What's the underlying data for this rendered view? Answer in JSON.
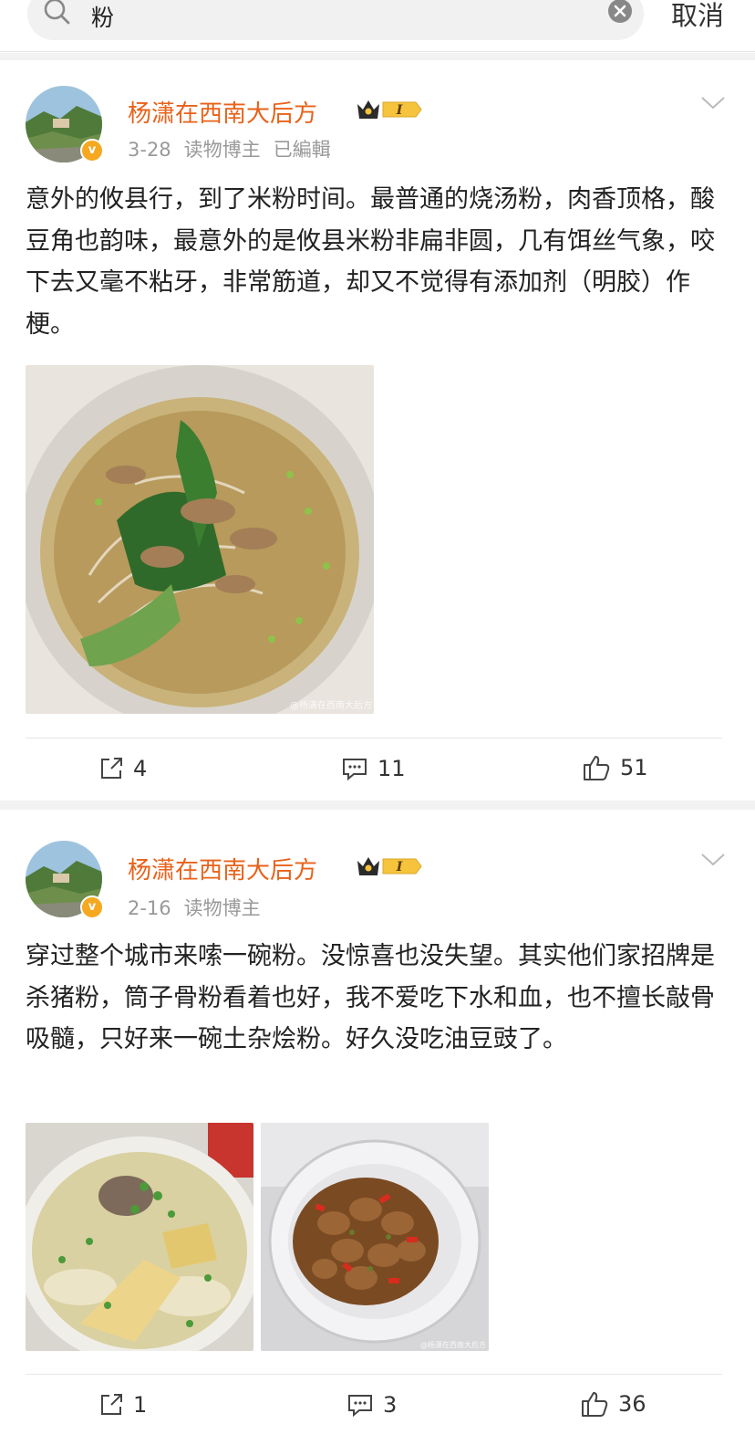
{
  "search": {
    "query": "粉",
    "cancel_label": "取消"
  },
  "posts": [
    {
      "author": "杨潇在西南大后方",
      "badge_level": "I",
      "date": "3-28",
      "tag": "读物博主",
      "edited": "已編輯",
      "text": "意外的攸县行，到了米粉时间。最普通的烧汤粉，肉香顶格，酸豆角也韵味，最意外的是攸县米粉非扁非圆，几有饵丝气象，咬下去又毫不粘牙，非常筋道，却又不觉得有添加剂（明胶）作梗。",
      "image_watermark": "@杨潇在西南大后方",
      "reposts": "4",
      "comments": "11",
      "likes": "51"
    },
    {
      "author": "杨潇在西南大后方",
      "badge_level": "I",
      "date": "2-16",
      "tag": "读物博主",
      "text": "穿过整个城市来嗦一碗粉。没惊喜也没失望。其实他们家招牌是杀猪粉，筒子骨粉看着也好，我不爱吃下水和血，也不擅长敲骨吸髓，只好来一碗土杂烩粉。好久没吃油豆豉了。",
      "image_watermark": "@杨潇在西南大后方",
      "reposts": "1",
      "comments": "3",
      "likes": "36"
    }
  ],
  "icons": {
    "search": "search-icon",
    "clear": "clear-icon",
    "more": "chevron-down-icon",
    "repost": "repost-icon",
    "comment": "comment-icon",
    "like": "like-icon"
  },
  "colors": {
    "author": "#e8621a",
    "meta": "#999999",
    "verified": "#f6a821"
  }
}
